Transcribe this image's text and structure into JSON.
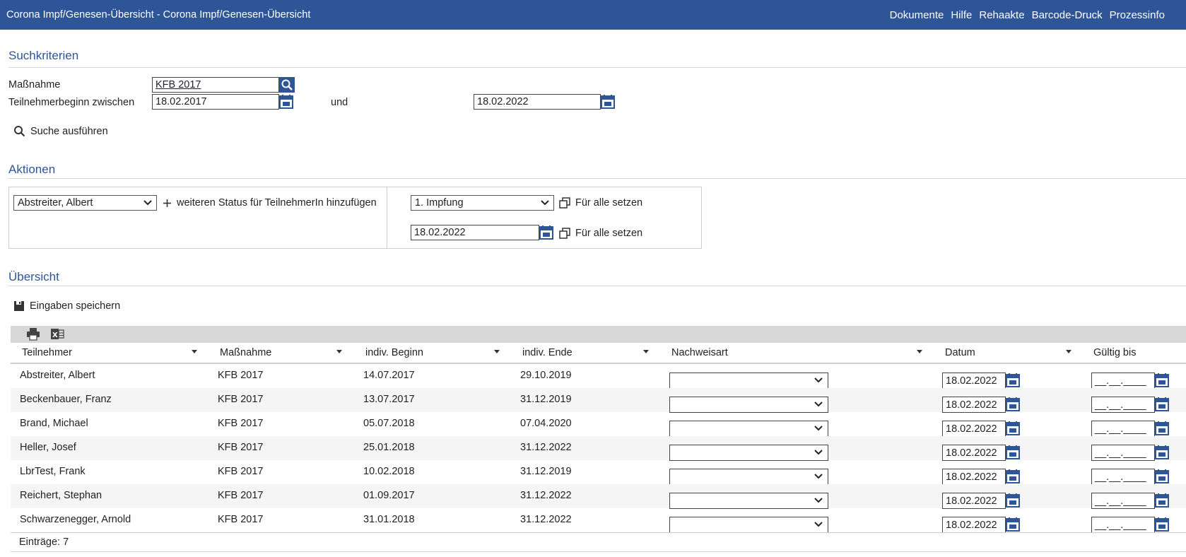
{
  "header": {
    "title": "Corona Impf/Genesen-Übersicht  -  Corona Impf/Genesen-Übersicht",
    "nav": [
      "Dokumente",
      "Hilfe",
      "Rehaakte",
      "Barcode-Druck",
      "Prozessinfo"
    ]
  },
  "search": {
    "section_title": "Suchkriterien",
    "massnahme_label": "Maßnahme",
    "massnahme_value": "KFB 2017",
    "beginn_label": "Teilnehmerbeginn zwischen",
    "date_from": "18.02.2017",
    "and_label": "und",
    "date_to": "18.02.2022",
    "run_label": "Suche ausführen"
  },
  "actions": {
    "section_title": "Aktionen",
    "participant_select": "Abstreiter, Albert",
    "add_status_label": "weiteren Status für TeilnehmerIn hinzufügen",
    "status_select": "1. Impfung",
    "set_all_label_1": "Für alle setzen",
    "date_value": "18.02.2022",
    "set_all_label_2": "Für alle setzen"
  },
  "overview": {
    "section_title": "Übersicht",
    "save_label": "Eingaben speichern",
    "columns": [
      "Teilnehmer",
      "Maßnahme",
      "indiv. Beginn",
      "indiv. Ende",
      "Nachweisart",
      "Datum",
      "Gültig bis"
    ],
    "rows": [
      {
        "name": "Abstreiter, Albert",
        "massnahme": "KFB 2017",
        "beginn": "14.07.2017",
        "ende": "29.10.2019",
        "nachweisart": "",
        "datum": "18.02.2022",
        "gueltig": "__.__.____"
      },
      {
        "name": "Beckenbauer, Franz",
        "massnahme": "KFB 2017",
        "beginn": "13.07.2017",
        "ende": "31.12.2019",
        "nachweisart": "",
        "datum": "18.02.2022",
        "gueltig": "__.__.____"
      },
      {
        "name": "Brand, Michael",
        "massnahme": "KFB 2017",
        "beginn": "05.07.2018",
        "ende": "07.04.2020",
        "nachweisart": "",
        "datum": "18.02.2022",
        "gueltig": "__.__.____"
      },
      {
        "name": "Heller, Josef",
        "massnahme": "KFB 2017",
        "beginn": "25.01.2018",
        "ende": "31.12.2022",
        "nachweisart": "",
        "datum": "18.02.2022",
        "gueltig": "__.__.____"
      },
      {
        "name": "LbrTest, Frank",
        "massnahme": "KFB 2017",
        "beginn": "10.02.2018",
        "ende": "31.12.2019",
        "nachweisart": "",
        "datum": "18.02.2022",
        "gueltig": "__.__.____"
      },
      {
        "name": "Reichert, Stephan",
        "massnahme": "KFB 2017",
        "beginn": "01.09.2017",
        "ende": "31.12.2022",
        "nachweisart": "",
        "datum": "18.02.2022",
        "gueltig": "__.__.____"
      },
      {
        "name": "Schwarzenegger, Arnold",
        "massnahme": "KFB 2017",
        "beginn": "31.01.2018",
        "ende": "31.12.2022",
        "nachweisart": "",
        "datum": "18.02.2022",
        "gueltig": "__.__.____"
      }
    ],
    "entries_label": "Einträge: 7"
  },
  "colors": {
    "header_bg": "#2e5597",
    "accent": "#2e5597"
  },
  "icons": [
    "search-icon",
    "calendar-icon",
    "plus-icon",
    "copy-icon",
    "save-icon",
    "print-icon",
    "excel-icon",
    "chevron-down-icon",
    "sort-arrow-icon"
  ]
}
